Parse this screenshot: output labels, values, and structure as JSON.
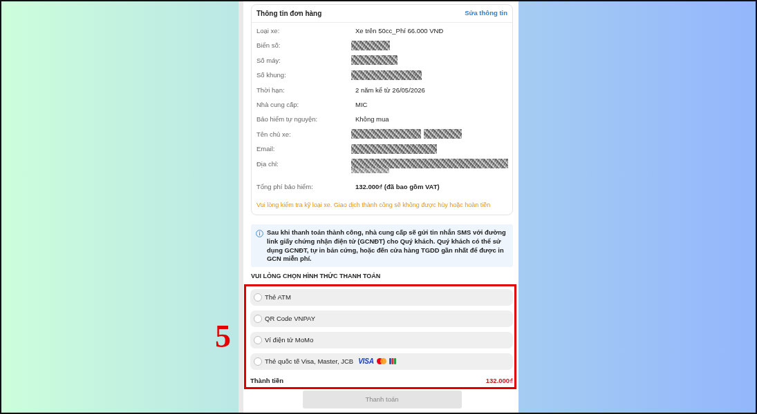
{
  "order_card": {
    "title": "Thông tin đơn hàng",
    "edit_link": "Sửa thông tin",
    "fields": [
      {
        "label": "Loại xe:",
        "kind": "text",
        "value": "Xe trên 50cc_Phí 66.000 VNĐ"
      },
      {
        "label": "Biển số:",
        "kind": "redacted"
      },
      {
        "label": "Số máy:",
        "kind": "redacted"
      },
      {
        "label": "Số khung:",
        "kind": "redacted"
      },
      {
        "label": "Thời hạn:",
        "kind": "text",
        "value": "2 năm kể từ 26/05/2026"
      },
      {
        "label": "Nhà cung cấp:",
        "kind": "text",
        "value": "MIC"
      },
      {
        "label": "Bảo hiểm tự nguyện:",
        "kind": "text",
        "value": "Không mua"
      },
      {
        "label": "Tên chủ xe:",
        "kind": "redacted"
      },
      {
        "label": "Email:",
        "kind": "redacted"
      },
      {
        "label": "Địa chỉ:",
        "kind": "redacted"
      }
    ],
    "total": {
      "label": "Tổng phí bảo hiểm:",
      "value": "132.000₫ (đã bao gồm VAT)"
    },
    "warning": "Vui lòng kiểm tra kỹ loại xe. Giao dịch thành công sẽ không được hủy hoặc hoàn tiền"
  },
  "notice": "Sau khi thanh toán thành công, nhà cung cấp sẽ gửi tin nhắn SMS với đường link giấy chứng nhận điện tử (GCNĐT) cho Quý khách. Quý khách có thể sử dụng GCNĐT, tự in bản cứng, hoặc đến cửa hàng TGDD gần nhất để được in GCN miễn phí.",
  "payment": {
    "heading": "VUI LÒNG CHỌN HÌNH THỨC THANH TOÁN",
    "options": [
      {
        "label": "Thẻ ATM",
        "selected": false
      },
      {
        "label": "QR Code VNPAY",
        "selected": false
      },
      {
        "label": "Ví điện tử MoMo",
        "selected": false
      },
      {
        "label": "Thẻ quốc tế Visa, Master, JCB",
        "selected": false,
        "logos": [
          {
            "kind": "visa",
            "text": "VISA"
          },
          {
            "kind": "mastercard"
          },
          {
            "kind": "jcb"
          }
        ]
      }
    ],
    "total_label": "Thành tiền",
    "total_value": "132.000₫",
    "pay_button": {
      "label": "Thanh toán",
      "disabled": true
    }
  },
  "annotation": {
    "step": "5"
  }
}
